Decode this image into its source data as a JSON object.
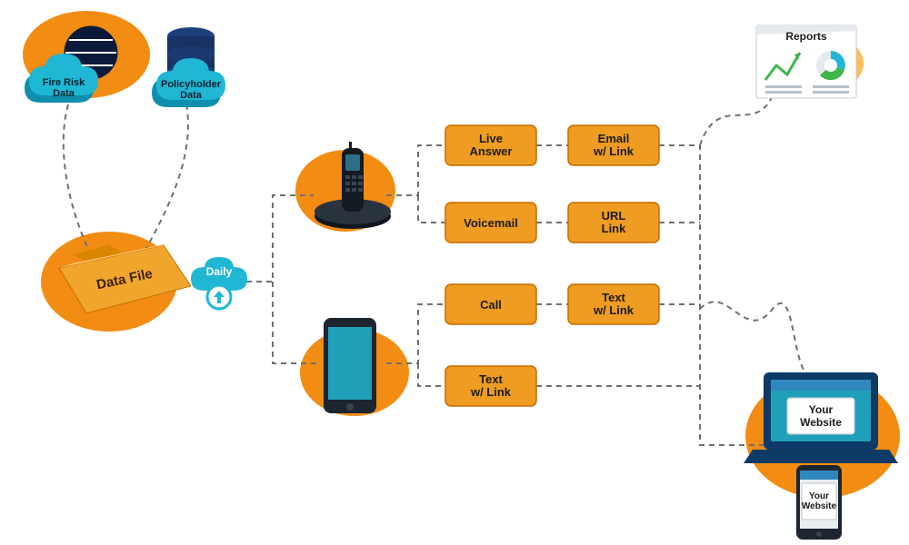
{
  "sources": {
    "fire_risk": "Fire Risk\nData",
    "policyholder": "Policyholder\nData"
  },
  "file": {
    "label": "Data File",
    "upload_tag": "Daily"
  },
  "channels": {
    "phone": {
      "live_answer": "Live\nAnswer",
      "voicemail": "Voicemail",
      "email_link": "Email\nw/ Link",
      "url_link": "URL\nLink"
    },
    "mobile": {
      "call": "Call",
      "text_link_1": "Text\nw/ Link",
      "text_link_2": "Text\nw/ Link"
    }
  },
  "outputs": {
    "reports": "Reports",
    "laptop": "Your\nWebsite",
    "phone_site": "Your\nWebsite"
  }
}
